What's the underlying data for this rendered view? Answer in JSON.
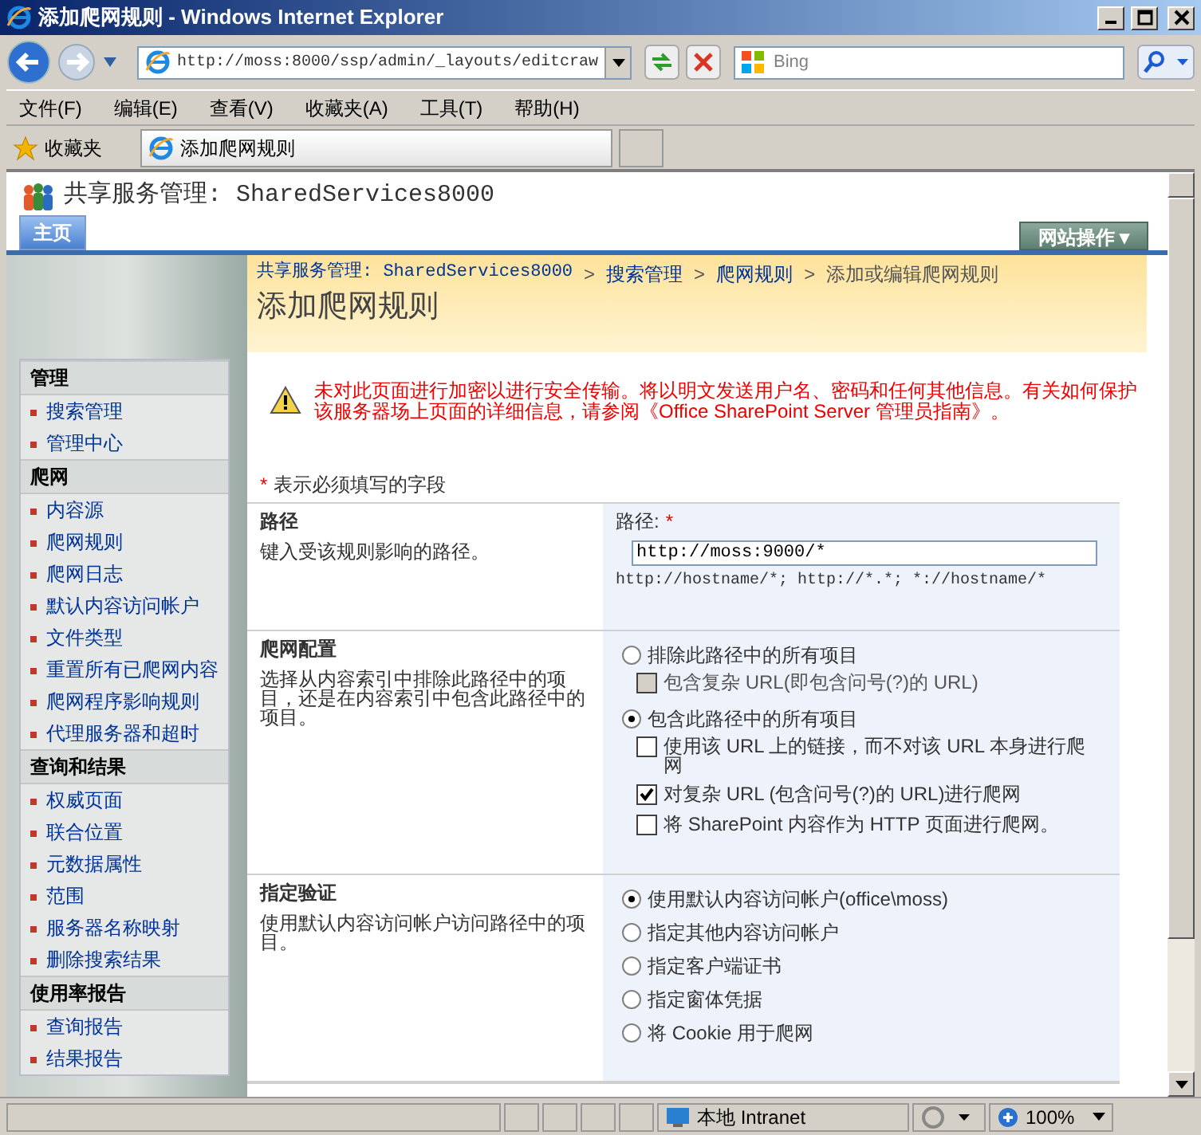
{
  "window": {
    "title": "添加爬网规则 - Windows Internet Explorer"
  },
  "address_bar": {
    "url": "http://moss:8000/ssp/admin/_layouts/editcraw"
  },
  "search": {
    "placeholder": "Bing"
  },
  "menu": [
    "文件(F)",
    "编辑(E)",
    "查看(V)",
    "收藏夹(A)",
    "工具(T)",
    "帮助(H)"
  ],
  "favorites_bar": {
    "label": "收藏夹",
    "tabs": [
      {
        "label": "添加爬网规则",
        "selected": true
      }
    ]
  },
  "site": {
    "title": "共享服务管理: SharedServices8000",
    "tabs": [
      {
        "label": "主页",
        "selected": true
      }
    ],
    "site_actions": "网站操作 ▾"
  },
  "breadcrumb": {
    "separator": ">",
    "items": [
      {
        "label": "共享服务管理: SharedServices8000",
        "link": true
      },
      {
        "label": "搜索管理",
        "link": true
      },
      {
        "label": "爬网规则",
        "link": true
      },
      {
        "label": "添加或编辑爬网规则",
        "link": false
      }
    ]
  },
  "page_title": "添加爬网规则",
  "sidebar": {
    "groups": [
      {
        "heading": "管理",
        "items": [
          "搜索管理",
          "管理中心"
        ]
      },
      {
        "heading": "爬网",
        "items": [
          "内容源",
          "爬网规则",
          "爬网日志",
          "默认内容访问帐户",
          "文件类型",
          "重置所有已爬网内容",
          "爬网程序影响规则",
          "代理服务器和超时"
        ]
      },
      {
        "heading": "查询和结果",
        "items": [
          "权威页面",
          "联合位置",
          "元数据属性",
          "范围",
          "服务器名称映射",
          "删除搜索结果"
        ]
      },
      {
        "heading": "使用率报告",
        "items": [
          "查询报告",
          "结果报告"
        ]
      }
    ]
  },
  "warning": "未对此页面进行加密以进行安全传输。将以明文发送用户名、密码和任何其他信息。有关如何保护该服务器场上页面的详细信息，请参阅《Office SharePoint Server 管理员指南》。",
  "required_note": {
    "mark": "*",
    "text": "表示必须填写的字段"
  },
  "sections": [
    {
      "title": "路径",
      "description": "键入受该规则影响的路径。",
      "kind": "text",
      "label": "路径:",
      "required_mark": "*",
      "value": "http://moss:9000/*",
      "hint": "http://hostname/*; http://*.*; *://hostname/*"
    },
    {
      "title": "爬网配置",
      "description": "选择从内容索引中排除此路径中的项目，还是在内容索引中包含此路径中的项目。",
      "kind": "options",
      "options": [
        {
          "kind": "radio",
          "label": "排除此路径中的所有项目",
          "selected": false,
          "children": [
            {
              "kind": "checkbox",
              "label": "包含复杂 URL(即包含问号(?)的 URL)",
              "checked": false,
              "disabled": true
            }
          ]
        },
        {
          "kind": "radio",
          "label": "包含此路径中的所有项目",
          "selected": true,
          "children": [
            {
              "kind": "checkbox",
              "label": "使用该 URL 上的链接，而不对该 URL 本身进行爬网",
              "checked": false,
              "disabled": false
            },
            {
              "kind": "checkbox",
              "label": "对复杂 URL (包含问号(?)的 URL)进行爬网",
              "checked": true,
              "disabled": false
            },
            {
              "kind": "checkbox",
              "label": "将 SharePoint 内容作为 HTTP 页面进行爬网。",
              "checked": false,
              "disabled": false
            }
          ]
        }
      ]
    },
    {
      "title": "指定验证",
      "description": "使用默认内容访问帐户访问路径中的项目。",
      "kind": "options",
      "options": [
        {
          "kind": "radio",
          "label": "使用默认内容访问帐户(office\\moss)",
          "selected": true
        },
        {
          "kind": "radio",
          "label": "指定其他内容访问帐户",
          "selected": false
        },
        {
          "kind": "radio",
          "label": "指定客户端证书",
          "selected": false
        },
        {
          "kind": "radio",
          "label": "指定窗体凭据",
          "selected": false
        },
        {
          "kind": "radio",
          "label": "将 Cookie 用于爬网",
          "selected": false
        }
      ]
    }
  ],
  "status_bar": {
    "zone": "本地 Intranet",
    "zoom": "100%"
  }
}
